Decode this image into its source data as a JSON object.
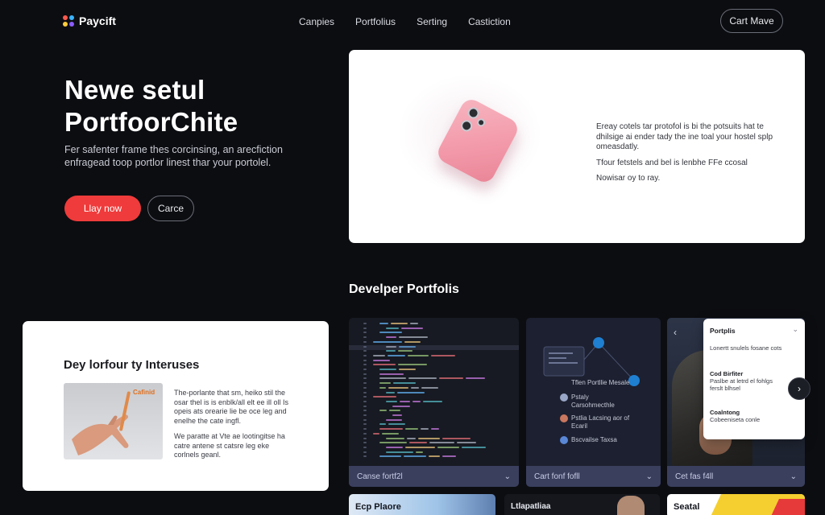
{
  "brand": {
    "name": "Paycift"
  },
  "nav": {
    "links": [
      "Canpies",
      "Portfolius",
      "Serting",
      "Castiction"
    ],
    "cta": "Cart Mave"
  },
  "hero": {
    "title_line1": "Newe setul",
    "title_line2": "PortfoorChite",
    "subtitle": "Fer safenter frame thes corcinsing, an arecfiction enfragead toop portlor linest thar your portolel.",
    "primary_button": "Llay now",
    "secondary_button": "Carce"
  },
  "product": {
    "para1": "Ereay cotels tar protofol is bi the potsuits hat te dhilsige ai ender tady the ine toal your hostel splp omeasdatly.",
    "para2": "Tfour fetstels and bel is lenbhe FFe ccosal",
    "para3": "Nowisar oy to ray."
  },
  "section": {
    "title": "Develper Portfolis"
  },
  "interests": {
    "title": "Dey lorfour ty Interuses",
    "image_tag": "Cafinid",
    "para1": "The-porlante that sm, heiko stil the osar thel is is enblk/all elt ee ill oll Is opeis ats orearie lie be oce leg and enelhe the cate ingfl.",
    "para2": "We paratte at Vte ae lootingitse ha catre antene st catsre leg eke corlnels geanl."
  },
  "cards": {
    "code_footer": "Canse fortf2l",
    "graph_footer": "Cart fonf fofll",
    "graph_items": [
      {
        "label": "Tflen Portllie Mesale"
      },
      {
        "label": "Pstaly Carsohmecthle"
      },
      {
        "label": "Pstlia Lacsing aor of Ecaril"
      },
      {
        "label": "Bscvailse Taxsa"
      }
    ],
    "photo_footer": "Cet fas f4ll",
    "popup_title": "Portplis",
    "popup_items": [
      {
        "title": "",
        "text": "Lonertt snulels fosane cots"
      },
      {
        "title": "Cod Birfiter",
        "text": "Paslbe at letrd el fohlgs ferslt blhsel"
      },
      {
        "title": "Coalntong",
        "text": "Cobeeniseta conle"
      }
    ],
    "bottom1": "Ecp Plaore",
    "bottom2": "Ltlapatliaa",
    "bottom3": "Seatal"
  },
  "icons": [
    "logo-icon",
    "chevron-down-icon",
    "chevron-right-icon",
    "chevron-left-icon",
    "node-icon",
    "avatar-icon"
  ],
  "colors": {
    "accent": "#ef3b3b",
    "background": "#0c0d11",
    "card_footer": "#3a3f5e",
    "phone": "#f39aaa"
  }
}
